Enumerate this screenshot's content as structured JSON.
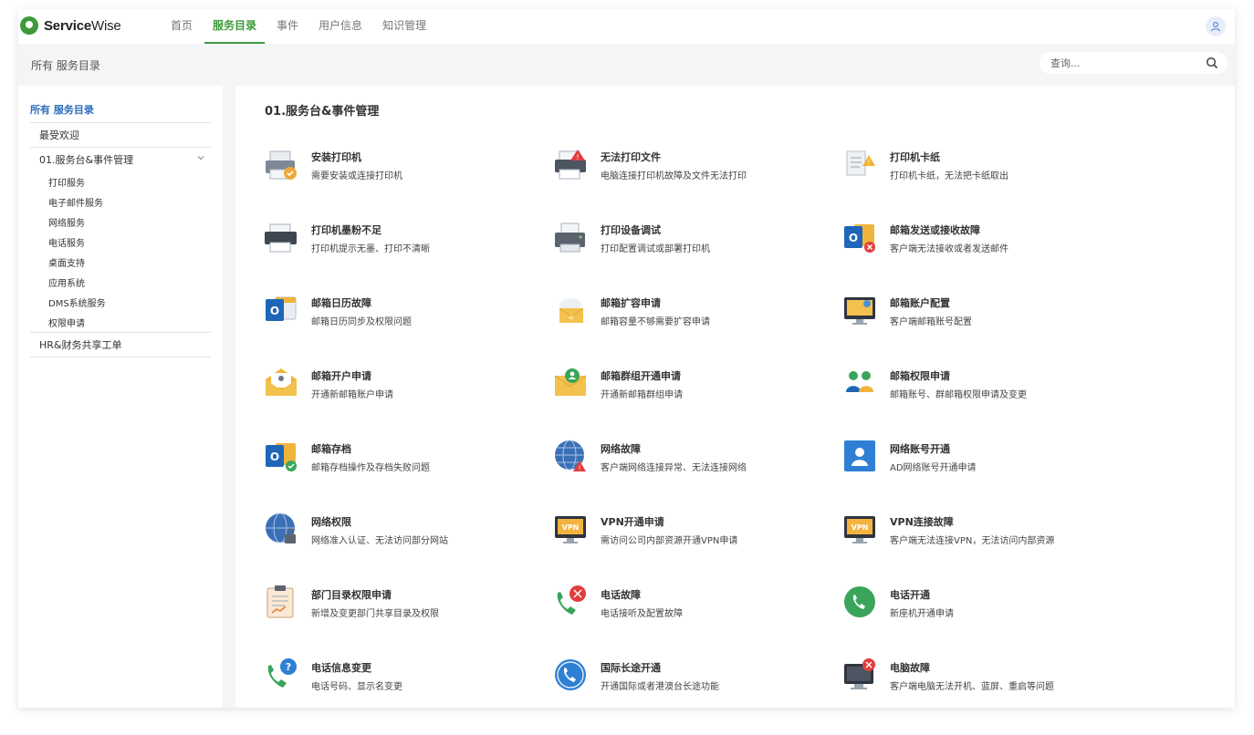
{
  "app": {
    "logo_bold": "Service",
    "logo_rest": "Wise"
  },
  "nav": {
    "tabs": [
      "首页",
      "服务目录",
      "事件",
      "用户信息",
      "知识管理"
    ],
    "active": 1
  },
  "breadcrumb": "所有 服务目录",
  "search": {
    "placeholder": "查询..."
  },
  "sidebar": {
    "title": "所有 服务目录",
    "favorite": "最受欢迎",
    "group": "01.服务台&事件管理",
    "subitems": [
      "打印服务",
      "电子邮件服务",
      "网络服务",
      "电话服务",
      "桌面支持",
      "应用系统",
      "DMS系统服务",
      "权限申请"
    ],
    "other": "HR&财务共享工单"
  },
  "main": {
    "section_title": "01.服务台&事件管理",
    "services": [
      {
        "title": "安装打印机",
        "desc": "需要安装或连接打印机",
        "icon": "printer-install-icon"
      },
      {
        "title": "无法打印文件",
        "desc": "电脑连接打印机故障及文件无法打印",
        "icon": "printer-error-icon"
      },
      {
        "title": "打印机卡纸",
        "desc": "打印机卡纸，无法把卡纸取出",
        "icon": "paper-jam-icon"
      },
      {
        "title": "打印机墨粉不足",
        "desc": "打印机提示无墨、打印不清晰",
        "icon": "printer-toner-icon"
      },
      {
        "title": "打印设备调试",
        "desc": "打印配置调试或部署打印机",
        "icon": "printer-setup-icon"
      },
      {
        "title": "邮箱发送或接收故障",
        "desc": "客户端无法接收或者发送邮件",
        "icon": "outlook-error-icon"
      },
      {
        "title": "邮箱日历故障",
        "desc": "邮箱日历同步及权限问题",
        "icon": "outlook-calendar-icon"
      },
      {
        "title": "邮箱扩容申请",
        "desc": "邮箱容量不够需要扩容申请",
        "icon": "mailbox-expand-icon"
      },
      {
        "title": "邮箱账户配置",
        "desc": "客户端邮箱账号配置",
        "icon": "mail-account-config-icon"
      },
      {
        "title": "邮箱开户申请",
        "desc": "开通新邮箱账户申请",
        "icon": "mail-open-account-icon"
      },
      {
        "title": "邮箱群组开通申请",
        "desc": "开通新邮箱群组申请",
        "icon": "mail-group-icon"
      },
      {
        "title": "邮箱权限申请",
        "desc": "邮箱账号、群邮箱权限申请及变更",
        "icon": "mail-permission-icon"
      },
      {
        "title": "邮箱存档",
        "desc": "邮箱存档操作及存档失败问题",
        "icon": "outlook-archive-icon"
      },
      {
        "title": "网络故障",
        "desc": "客户端网络连接异常、无法连接网络",
        "icon": "network-error-icon"
      },
      {
        "title": "网络账号开通",
        "desc": "AD网络账号开通申请",
        "icon": "network-account-icon"
      },
      {
        "title": "网络权限",
        "desc": "网络准入认证、无法访问部分网站",
        "icon": "network-permission-icon"
      },
      {
        "title": "VPN开通申请",
        "desc": "需访问公司内部资源开通VPN申请",
        "icon": "vpn-open-icon"
      },
      {
        "title": "VPN连接故障",
        "desc": "客户端无法连接VPN，无法访问内部资源",
        "icon": "vpn-error-icon"
      },
      {
        "title": "部门目录权限申请",
        "desc": "新增及变更部门共享目录及权限",
        "icon": "clipboard-icon"
      },
      {
        "title": "电话故障",
        "desc": "电话接听及配置故障",
        "icon": "phone-repair-icon"
      },
      {
        "title": "电话开通",
        "desc": "新座机开通申请",
        "icon": "phone-open-icon"
      },
      {
        "title": "电话信息变更",
        "desc": "电话号码、显示名变更",
        "icon": "phone-info-icon"
      },
      {
        "title": "国际长途开通",
        "desc": "开通国际或者港澳台长途功能",
        "icon": "international-call-icon"
      },
      {
        "title": "电脑故障",
        "desc": "客户端电脑无法开机、蓝屏、重启等问题",
        "icon": "computer-repair-icon"
      }
    ]
  }
}
